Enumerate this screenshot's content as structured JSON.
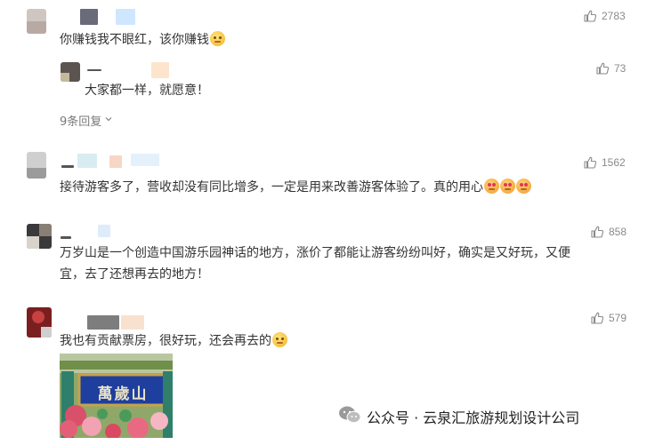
{
  "comments": [
    {
      "text": "你赚钱我不眼红，该你赚钱",
      "likes": "2783",
      "reply": {
        "text": "大家都一样，就愿意！",
        "likes": "73"
      },
      "more_replies": "9条回复"
    },
    {
      "text": "接待游客多了，营收却没有同比增多，一定是用来改善游客体验了。真的用心",
      "likes": "1562"
    },
    {
      "text_line1": "万岁山是一个创造中国游乐园神话的地方，涨价了都能让游客纷纷叫好，确实是又好玩，又便",
      "text_line2": "宜，去了还想再去的地方！",
      "likes": "858"
    },
    {
      "text": "我也有贡献票房，很好玩，还会再去的",
      "likes": "579",
      "photo_sign": "萬歲山"
    }
  ],
  "watermark": {
    "text": "公众号 · 云泉汇旅游规划设计公司"
  },
  "colors": {
    "text": "#333333",
    "meta": "#8a8a8a",
    "sign_blue": "#1f3f9e"
  },
  "icons": [
    "thumbs-up-icon",
    "chevron-down-icon",
    "wechat-icon",
    "emoji-icon"
  ]
}
